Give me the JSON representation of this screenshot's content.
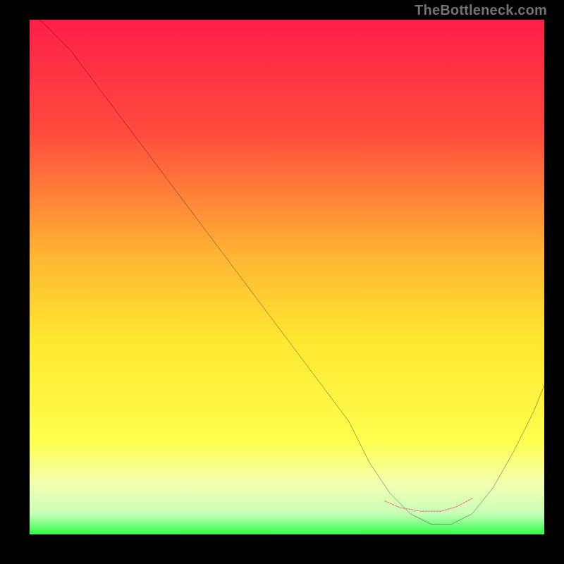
{
  "watermark": "TheBottleneck.com",
  "chart_data": {
    "type": "line",
    "title": "",
    "xlabel": "",
    "ylabel": "",
    "xlim": [
      0,
      100
    ],
    "ylim": [
      0,
      100
    ],
    "grid": false,
    "legend": null,
    "gradient_stops": [
      {
        "offset": 0,
        "color": "#ff1e49"
      },
      {
        "offset": 22,
        "color": "#ff4b3d"
      },
      {
        "offset": 45,
        "color": "#ffb234"
      },
      {
        "offset": 62,
        "color": "#ffe72f"
      },
      {
        "offset": 82,
        "color": "#fdff4e"
      },
      {
        "offset": 90,
        "color": "#f4ffb0"
      },
      {
        "offset": 96,
        "color": "#c8ffb8"
      },
      {
        "offset": 100,
        "color": "#2dff4c"
      }
    ],
    "series": [
      {
        "name": "bottleneck-curve",
        "color": "#000000",
        "x": [
          2,
          8,
          14,
          20,
          26,
          32,
          38,
          44,
          50,
          56,
          62,
          66,
          70,
          74,
          78,
          82,
          86,
          90,
          94,
          98,
          100
        ],
        "y": [
          100,
          94,
          86,
          78,
          70,
          62,
          54,
          46,
          38,
          30,
          22,
          14,
          8,
          4,
          2,
          2,
          4,
          9,
          16,
          24,
          29
        ]
      }
    ],
    "highlight": {
      "name": "optimal-range",
      "color": "#ef7079",
      "style": "dashed",
      "x": [
        69,
        72,
        76,
        80,
        83,
        86
      ],
      "y": [
        6.5,
        5.2,
        4.5,
        4.5,
        5.4,
        7.0
      ]
    }
  }
}
